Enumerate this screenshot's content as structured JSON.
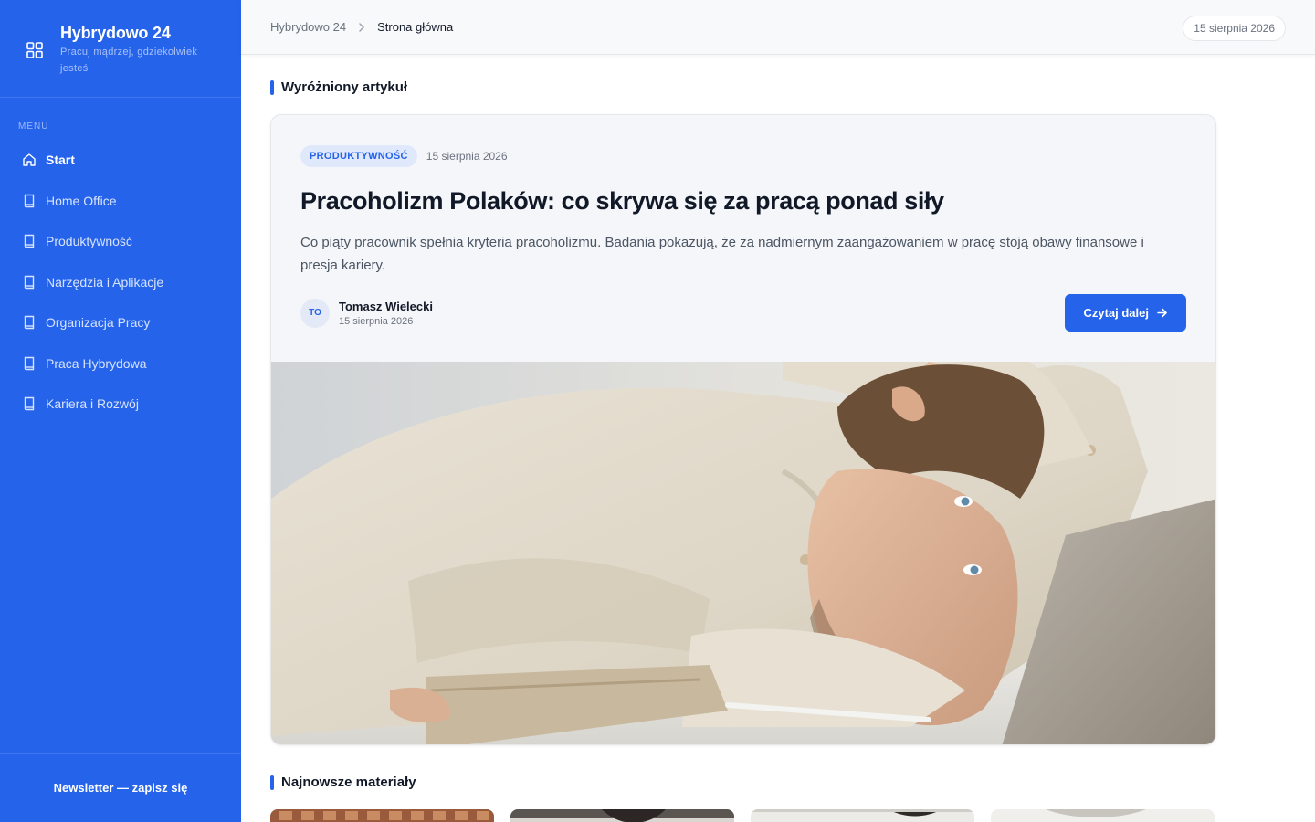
{
  "brand": {
    "title": "Hybrydowo 24",
    "tagline": "Pracuj mądrzej, gdziekolwiek jesteś",
    "icon": "grid-icon"
  },
  "sidebar": {
    "menu_heading": "MENU",
    "items": [
      {
        "label": "Start",
        "icon": "home-icon",
        "active": true
      },
      {
        "label": "Home Office",
        "icon": "book-icon"
      },
      {
        "label": "Produktywność",
        "icon": "book-icon"
      },
      {
        "label": "Narzędzia i Aplikacje",
        "icon": "book-icon"
      },
      {
        "label": "Organizacja Pracy",
        "icon": "book-icon"
      },
      {
        "label": "Praca Hybrydowa",
        "icon": "book-icon"
      },
      {
        "label": "Kariera i Rozwój",
        "icon": "book-icon"
      }
    ],
    "newsletter": "Newsletter — zapisz się"
  },
  "topbar": {
    "breadcrumb_home": "Hybrydowo 24",
    "breadcrumb_current": "Strona główna",
    "date": "15 sierpnia 2026"
  },
  "featured": {
    "section_title": "Wyróżniony artykuł",
    "tag": "PRODUKTYWNOŚĆ",
    "date": "15 sierpnia 2026",
    "title": "Pracoholizm Polaków: co skrywa się za pracą ponad siły",
    "excerpt": "Co piąty pracownik spełnia kryteria pracoholizmu. Badania pokazują, że za nadmiernym zaangażowaniem w pracę stoją obawy finansowe i presja kariery.",
    "author": {
      "initials": "TO",
      "name": "Tomasz Wielecki",
      "date": "15 sierpnia 2026"
    },
    "read_more": "Czytaj dalej"
  },
  "latest": {
    "section_title": "Najnowsze materiały"
  },
  "colors": {
    "accent": "#2563eb",
    "sidebar_bg": "#2563eb",
    "card_bg": "#f5f6f9"
  }
}
